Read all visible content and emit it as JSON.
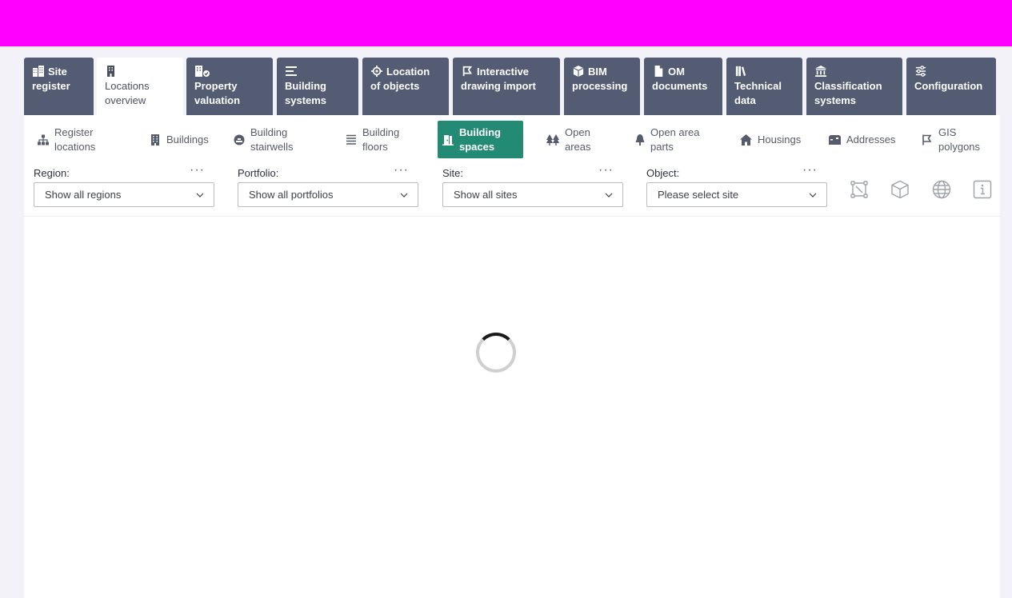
{
  "main_tabs": [
    {
      "line1": "Site",
      "line2": "register",
      "icon": "building-grid-icon"
    },
    {
      "line1": "Locations",
      "line2": "overview",
      "icon": "building-icon",
      "active": true
    },
    {
      "line1": "Property",
      "line2": "valuation",
      "icon": "building-check-icon"
    },
    {
      "line1": "Building",
      "line2": "systems",
      "icon": "list-icon"
    },
    {
      "line1": "Location",
      "line2": "of objects",
      "icon": "crosshair-icon"
    },
    {
      "line1": "Interactive",
      "line2": "drawing import",
      "icon": "polygon-flag-icon"
    },
    {
      "line1": "BIM",
      "line2": "processing",
      "icon": "cube-icon"
    },
    {
      "line1": "OM",
      "line2": "documents",
      "icon": "document-icon"
    },
    {
      "line1": "Technical",
      "line2": "data",
      "icon": "books-icon"
    },
    {
      "line1": "Classification",
      "line2": "systems",
      "icon": "institution-icon"
    },
    {
      "line1": "Configuration",
      "line2": "",
      "icon": "sliders-icon"
    }
  ],
  "sub_tabs": [
    {
      "line1": "Register",
      "line2": "locations",
      "icon": "hierarchy-icon"
    },
    {
      "line1": "Buildings",
      "line2": "",
      "icon": "building-icon"
    },
    {
      "line1": "Building",
      "line2": "stairwells",
      "icon": "stairs-circle-icon"
    },
    {
      "line1": "Building",
      "line2": "floors",
      "icon": "floors-icon"
    },
    {
      "line1": "Building",
      "line2": "spaces",
      "icon": "door-open-icon",
      "active": true
    },
    {
      "line1": "Open",
      "line2": "areas",
      "icon": "trees-icon"
    },
    {
      "line1": "Open area",
      "line2": "parts",
      "icon": "tree-icon"
    },
    {
      "line1": "Housings",
      "line2": "",
      "icon": "house-icon"
    },
    {
      "line1": "Addresses",
      "line2": "",
      "icon": "mailbox-icon"
    },
    {
      "line1": "GIS",
      "line2": "polygons",
      "icon": "polygon-flag-icon"
    }
  ],
  "filters": {
    "region": {
      "label": "Region:",
      "value": "Show all regions"
    },
    "portfolio": {
      "label": "Portfolio:",
      "value": "Show all portfolios"
    },
    "site": {
      "label": "Site:",
      "value": "Show all sites"
    },
    "object": {
      "label": "Object:",
      "value": "Please select site"
    },
    "more": "···"
  },
  "tools": [
    "polygon-nodes-icon",
    "cube-outline-icon",
    "globe-icon",
    "info-icon"
  ],
  "colors": {
    "topbar": "#ff00ff",
    "tab_bg": "#535c72",
    "active_sub_tab": "#238a73"
  }
}
